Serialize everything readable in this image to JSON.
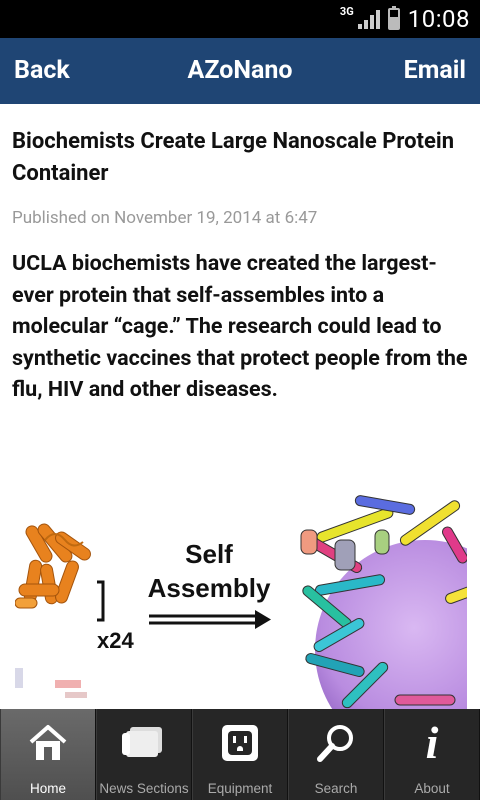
{
  "status": {
    "network": "3G",
    "time": "10:08"
  },
  "header": {
    "back_label": "Back",
    "title": "AZoNano",
    "email_label": "Email"
  },
  "article": {
    "headline": "Biochemists Create Large Nanoscale Protein Container",
    "published": "Published on November 19, 2014 at 6:47",
    "lead": "UCLA biochemists have created the largest-ever protein that self-assembles into a molecular “cage.” The research could lead to synthetic vaccines that protect people from the flu, HIV and other diseases.",
    "figure": {
      "label_line1": "Self",
      "label_line2": "Assembly",
      "multiplier": "x24"
    }
  },
  "tabs": [
    {
      "label": "Home",
      "icon": "home-icon",
      "active": true
    },
    {
      "label": "News Sections",
      "icon": "news-sections-icon",
      "active": false
    },
    {
      "label": "Equipment",
      "icon": "outlet-icon",
      "active": false
    },
    {
      "label": "Search",
      "icon": "search-icon",
      "active": false
    },
    {
      "label": "About",
      "icon": "info-icon",
      "active": false
    }
  ],
  "colors": {
    "header_bg": "#1f4574",
    "tabbar_bg": "#262626",
    "date_text": "#999999"
  }
}
